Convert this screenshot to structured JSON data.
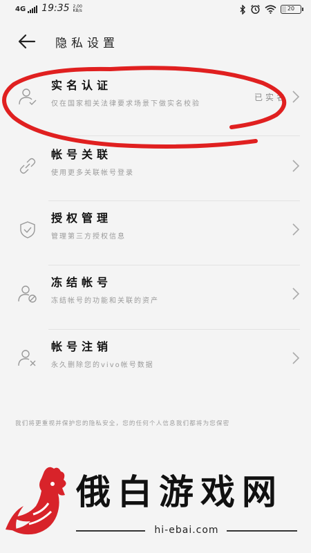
{
  "status_bar": {
    "network": "4G",
    "time": "19:35",
    "speed_value": "2.00",
    "speed_unit": "KB/s",
    "battery": "20",
    "battery_level": 0.2
  },
  "header": {
    "title": "隐私设置"
  },
  "items": [
    {
      "title": "实名认证",
      "desc": "仅在国家相关法律要求场景下做实名校验",
      "value": "已实名",
      "icon": "person-check-icon"
    },
    {
      "title": "帐号关联",
      "desc": "使用更多关联帐号登录",
      "value": "",
      "icon": "link-icon"
    },
    {
      "title": "授权管理",
      "desc": "管理第三方授权信息",
      "value": "",
      "icon": "shield-check-icon"
    },
    {
      "title": "冻结帐号",
      "desc": "冻结帐号的功能和关联的资产",
      "value": "",
      "icon": "person-lock-icon"
    },
    {
      "title": "帐号注销",
      "desc": "永久删除您的vivo帐号数据",
      "value": "",
      "icon": "person-remove-icon"
    }
  ],
  "footer_note": "我们将更重视并保护您的隐私安全，您的任何个人信息我们都将为您保密",
  "watermark": {
    "brand": "俄白游戏网",
    "url": "hi-ebai.com"
  },
  "colors": {
    "annotation_red": "#e02020",
    "logo_red": "#d8232a"
  }
}
